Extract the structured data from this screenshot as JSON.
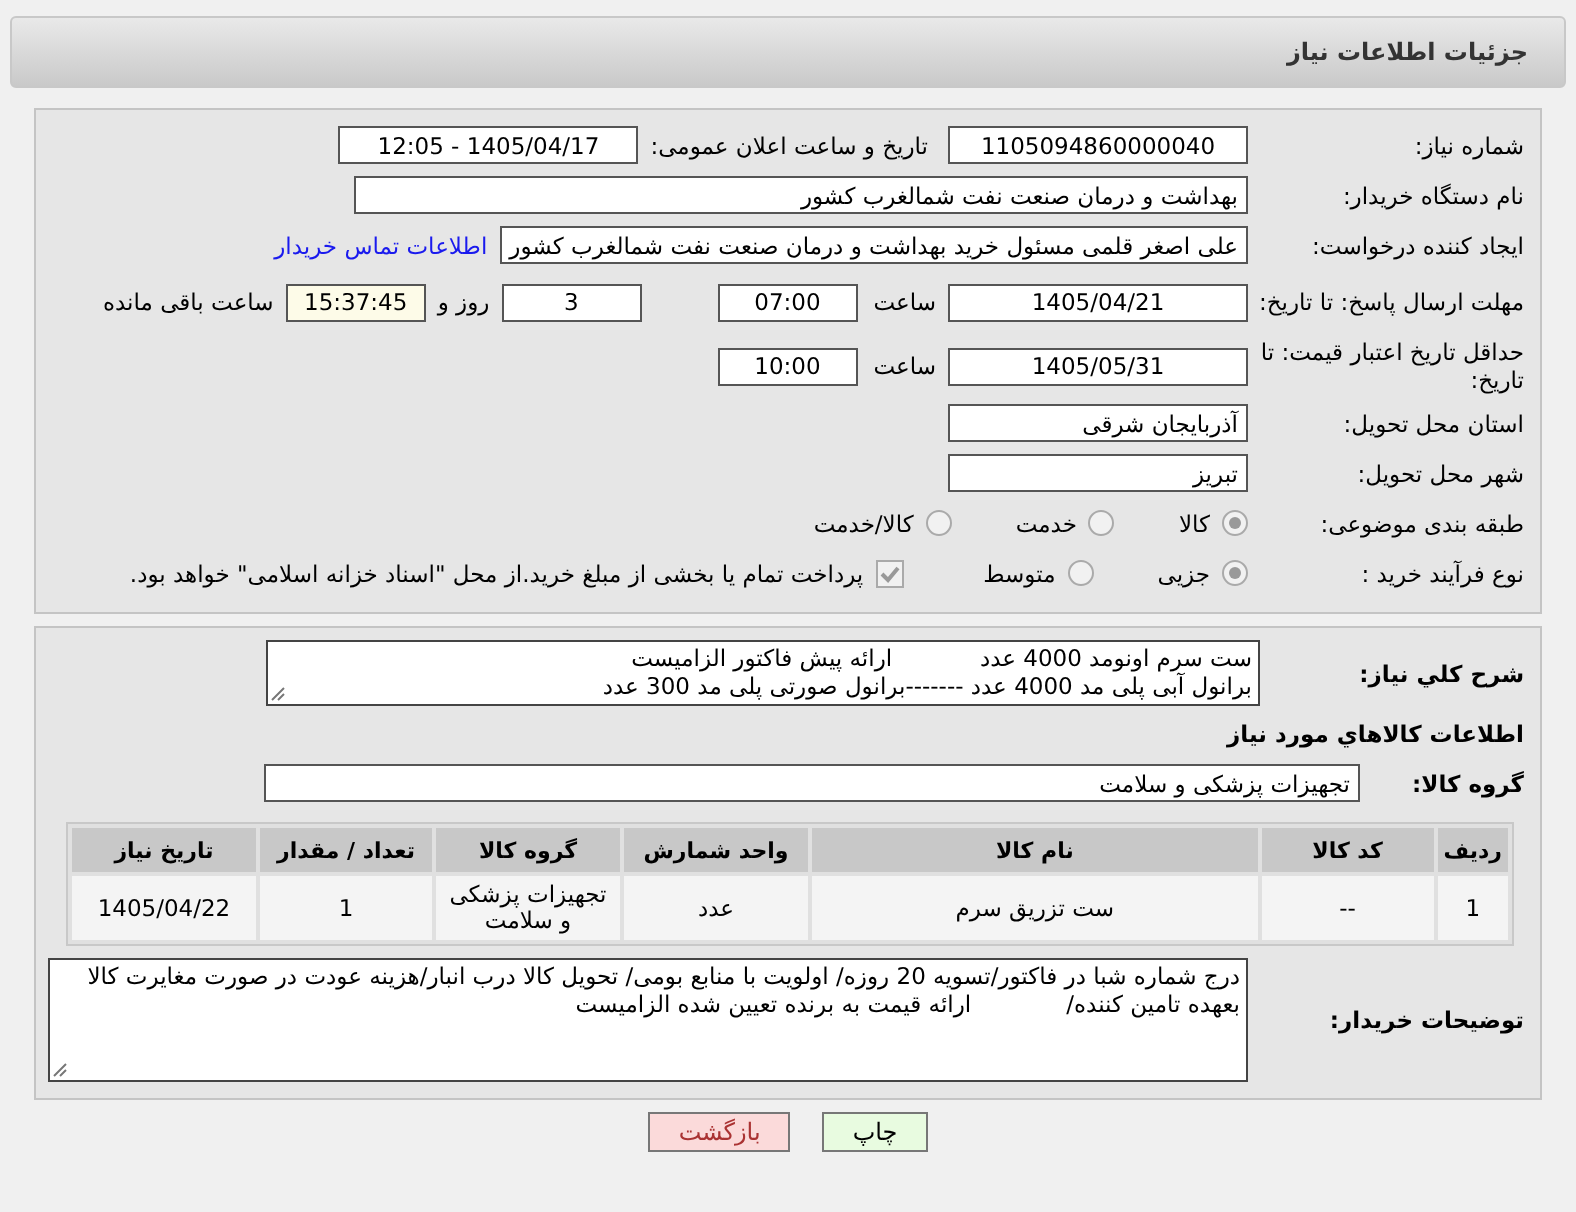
{
  "header": {
    "title": "جزئیات اطلاعات نیاز"
  },
  "need_number": {
    "label": "شماره نیاز:",
    "value": "1105094860000040"
  },
  "announce": {
    "label": "تاریخ و ساعت اعلان عمومی:",
    "value": "1405/04/17 - 12:05"
  },
  "buyer_org": {
    "label": "نام دستگاه خریدار:",
    "value": "بهداشت و درمان صنعت نفت شمالغرب کشور"
  },
  "requester": {
    "label": "ایجاد کننده درخواست:",
    "value": "علی اصغر قلمی مسئول خرید بهداشت و درمان صنعت نفت شمالغرب کشور",
    "link": "اطلاعات تماس خریدار"
  },
  "deadline": {
    "label": "مهلت ارسال پاسخ: تا تاریخ:",
    "date": "1405/04/21",
    "time_label": "ساعت",
    "time": "07:00",
    "days": "3",
    "days_label": "روز و",
    "remaining": "15:37:45",
    "remaining_label": "ساعت باقی مانده"
  },
  "price_validity": {
    "label": "حداقل تاریخ اعتبار قیمت: تا تاریخ:",
    "date": "1405/05/31",
    "time_label": "ساعت",
    "time": "10:00"
  },
  "province": {
    "label": "استان محل تحویل:",
    "value": "آذربایجان شرقی"
  },
  "city": {
    "label": "شهر محل تحویل:",
    "value": "تبریز"
  },
  "category": {
    "label": "طبقه بندی موضوعی:",
    "options": [
      {
        "label": "کالا",
        "selected": true
      },
      {
        "label": "خدمت",
        "selected": false
      },
      {
        "label": "کالا/خدمت",
        "selected": false
      }
    ]
  },
  "process": {
    "label": "نوع فرآیند خرید :",
    "options": [
      {
        "label": "جزیی",
        "selected": true
      },
      {
        "label": "متوسط",
        "selected": false
      }
    ],
    "treasury": {
      "checked": true,
      "text": "پرداخت تمام یا بخشی از مبلغ خرید.از محل \"اسناد خزانه اسلامی\" خواهد بود."
    }
  },
  "description": {
    "label": "شرح کلي نیاز:",
    "text": "ست سرم اونومد 4000 عدد            ارائه پیش فاکتور الزامیست\nبرانول آبی پلی مد 4000 عدد -------برانول صورتی پلی مد 300 عدد"
  },
  "goods": {
    "title": "اطلاعات کالاهاي مورد نیاز",
    "group_label": "گروه کالا:",
    "group": "تجهیزات پزشکی و سلامت",
    "columns": [
      "ردیف",
      "کد کالا",
      "نام کالا",
      "واحد شمارش",
      "گروه کالا",
      "تعداد / مقدار",
      "تاریخ نیاز"
    ],
    "rows": [
      [
        "1",
        "--",
        "ست تزریق سرم",
        "عدد",
        "تجهیزات پزشکی و سلامت",
        "1",
        "1405/04/22"
      ]
    ]
  },
  "buyer_notes": {
    "label": "توضیحات خریدار:",
    "text": "درج شماره شبا در فاکتور/تسویه 20 روزه/ اولویت با منابع بومی/ تحویل کالا درب انبار/هزینه عودت در صورت مغایرت کالا بعهده تامین کننده/             ارائه قیمت به برنده تعیین شده الزامیست"
  },
  "buttons": [
    {
      "label": "چاپ",
      "kind": "print"
    },
    {
      "label": "بازگشت",
      "kind": "back"
    }
  ]
}
